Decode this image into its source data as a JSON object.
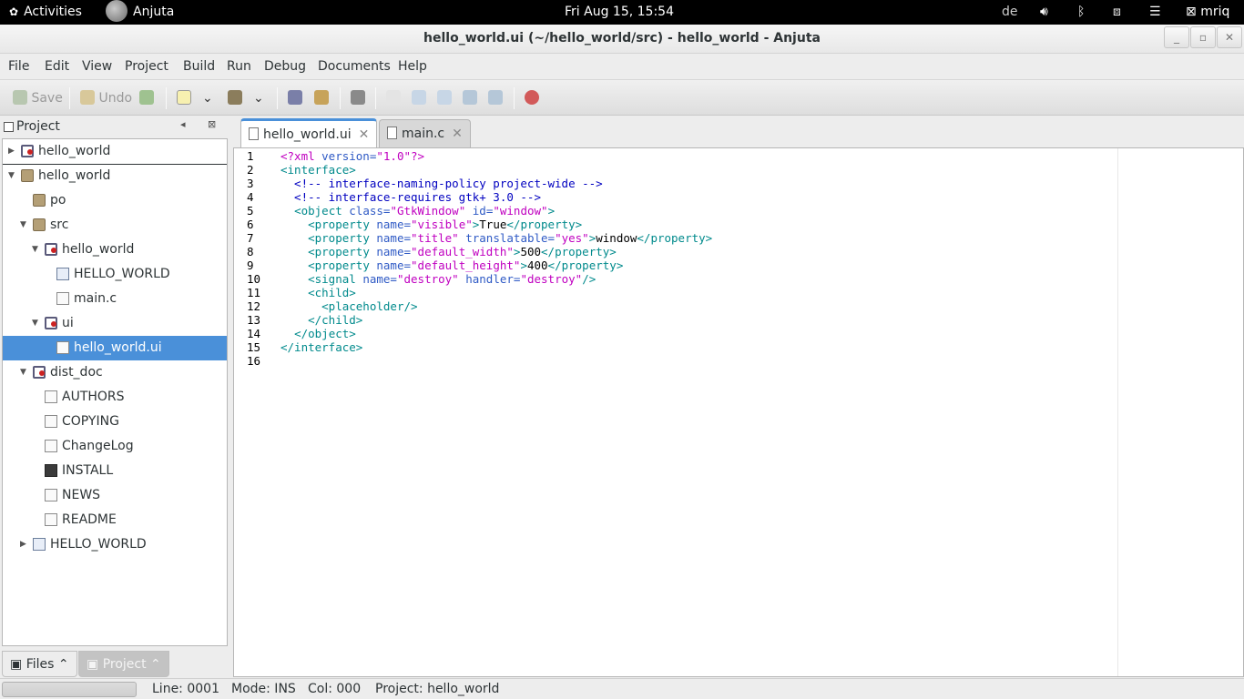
{
  "topbar": {
    "activities": "Activities",
    "app_name": "Anjuta",
    "clock": "Fri Aug 15, 15:54",
    "keyboard_layout": "de",
    "user": "mriq"
  },
  "window": {
    "title": "hello_world.ui (~/hello_world/src) - hello_world - Anjuta"
  },
  "menubar": [
    "File",
    "Edit",
    "View",
    "Project",
    "Build",
    "Run",
    "Debug",
    "Documents",
    "Help"
  ],
  "toolbar": {
    "save_label": "Save",
    "undo_label": "Undo"
  },
  "project_pane": {
    "title": "Project",
    "tree": [
      {
        "label": "hello_world",
        "icon": "target-icon",
        "arrow": "collapsed"
      },
      {
        "label": "hello_world",
        "icon": "folder-icon",
        "arrow": "expanded"
      },
      {
        "label": "po",
        "icon": "folder-icon",
        "arrow": "none"
      },
      {
        "label": "src",
        "icon": "folder-icon",
        "arrow": "expanded"
      },
      {
        "label": "hello_world",
        "icon": "target-icon",
        "arrow": "expanded"
      },
      {
        "label": "HELLO_WORLD",
        "icon": "library-icon",
        "arrow": "none"
      },
      {
        "label": "main.c",
        "icon": "file-icon",
        "arrow": "none"
      },
      {
        "label": "ui",
        "icon": "target-icon",
        "arrow": "expanded"
      },
      {
        "label": "hello_world.ui",
        "icon": "ui-file-icon",
        "arrow": "none",
        "selected": true
      },
      {
        "label": "dist_doc",
        "icon": "target-icon",
        "arrow": "expanded"
      },
      {
        "label": "AUTHORS",
        "icon": "file-icon",
        "arrow": "none"
      },
      {
        "label": "COPYING",
        "icon": "file-icon",
        "arrow": "none"
      },
      {
        "label": "ChangeLog",
        "icon": "file-icon",
        "arrow": "none"
      },
      {
        "label": "INSTALL",
        "icon": "executable-icon",
        "arrow": "none"
      },
      {
        "label": "NEWS",
        "icon": "file-icon",
        "arrow": "none"
      },
      {
        "label": "README",
        "icon": "file-icon",
        "arrow": "none"
      },
      {
        "label": "HELLO_WORLD",
        "icon": "library-icon",
        "arrow": "collapsed"
      }
    ],
    "bottom_tabs": [
      "Files",
      "Project"
    ]
  },
  "editor": {
    "tabs": [
      {
        "label": "hello_world.ui",
        "active": true
      },
      {
        "label": "main.c",
        "active": false
      }
    ],
    "line_numbers": [
      "1",
      "2",
      "3",
      "4",
      "5",
      "6",
      "7",
      "8",
      "9",
      "10",
      "11",
      "12",
      "13",
      "14",
      "15",
      "16"
    ],
    "lines": [
      "<?xml version=\"1.0\"?>",
      "<interface>",
      "  <!-- interface-naming-policy project-wide -->",
      "  <!-- interface-requires gtk+ 3.0 -->",
      "  <object class=\"GtkWindow\" id=\"window\">",
      "    <property name=\"visible\">True</property>",
      "    <property name=\"title\" translatable=\"yes\">window</property>",
      "    <property name=\"default_width\">500</property>",
      "    <property name=\"default_height\">400</property>",
      "    <signal name=\"destroy\" handler=\"destroy\"/>",
      "    <child>",
      "      <placeholder/>",
      "    </child>",
      "  </object>",
      "</interface>",
      ""
    ]
  },
  "statusbar": {
    "line": "Line: 0001",
    "mode": "Mode: INS",
    "col": "Col: 000",
    "project": "Project: hello_world"
  },
  "colors": {
    "selection": "#4a90d9",
    "xml_tag": "#008a8c",
    "xml_attr": "#2f5ac5",
    "xml_string": "#c000c0",
    "xml_comment": "#0000c0"
  }
}
